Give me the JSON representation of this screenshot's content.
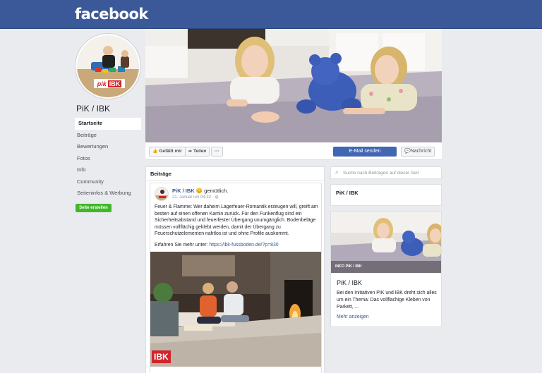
{
  "header": {
    "logo_text": "facebook",
    "color": "#3b5998"
  },
  "page": {
    "name": "PiK / IBK",
    "logo_badge": "IBK",
    "logo_prefix": "pik"
  },
  "sidebar": {
    "items": [
      {
        "label": "Startseite",
        "active": true
      },
      {
        "label": "Beiträge"
      },
      {
        "label": "Bewertungen"
      },
      {
        "label": "Fotos"
      },
      {
        "label": "Info"
      },
      {
        "label": "Community"
      },
      {
        "label": "Seiteninfos & Werbung"
      }
    ],
    "create_label": "Seite erstellen"
  },
  "actions": {
    "like_label": "Gefällt mir",
    "share_label": "Teilen",
    "more_label": "···",
    "email_label": "E-Mail senden",
    "message_label": "Nachricht"
  },
  "posts": {
    "header": "Beiträge",
    "post": {
      "author": "PiK / IBK",
      "feeling": "gemütlich.",
      "date": "21. Januar um 04:32",
      "text": "Feuer & Flamme: Wer daheim Lagerfeuer-Romantik erzeugen will, greift am besten auf einen offenen Kamin zurück. Für den Funkenflug sind ein Sicherheitsabstand und feuerfester Übergang unumgänglich. Bodenbeläge müssen vollflächig geklebt werden, damit der Übergang zu Feuerschutzelementen nahtlos ist und ohne Profile auskommt.",
      "link_prefix": "Erfahren Sie mehr unter:",
      "link_url": "https://ibk-fussboden.de/?p=830",
      "image_badge": "IBK"
    }
  },
  "right": {
    "search_placeholder": "Suche nach Beiträgen auf dieser Seit",
    "card1_title": "PiK / IBK",
    "card2": {
      "caption": "INFO PIK / IBK",
      "title": "PiK / IBK",
      "description": "Bei den Initiativen PIK und IBK dreht sich alles um ein Thema: Das vollflächige Kleben von Parkett, ...",
      "more_label": "Mehr anzeigen"
    }
  },
  "colors": {
    "accent": "#4267b2",
    "green": "#42b72a",
    "brand_red": "#d2232a"
  }
}
